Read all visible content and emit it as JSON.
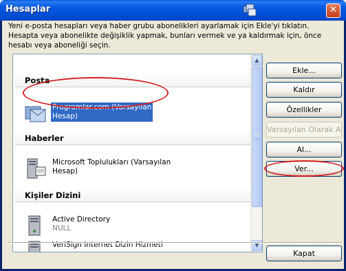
{
  "window": {
    "title": "Hesaplar",
    "close_glyph": "✕",
    "title_icon": "accounts-window-icon"
  },
  "description": "Yeni e-posta hesapları veya haber grubu abonelikleri ayarlamak için Ekle'yi tıklatın. Hesapta veya abonelikte değişiklik yapmak, bunları vermek ve ya kaldırmak için, önce hesabı veya aboneliği seçin.",
  "sections": [
    {
      "header": "Posta",
      "items": [
        {
          "icon": "mail-account-icon",
          "line1": "Programlar.com (Varsayılan",
          "line2": "Hesap)",
          "selected": true
        }
      ]
    },
    {
      "header": "Haberler",
      "items": [
        {
          "icon": "news-server-icon",
          "line1": "Microsoft Toplulukları (Varsayılan",
          "line2": "Hesap)",
          "selected": false
        }
      ]
    },
    {
      "header": "Kişiler Dizini",
      "items": [
        {
          "icon": "directory-server-icon",
          "line1": "Active Directory",
          "line2": "NULL",
          "selected": false
        },
        {
          "icon": "directory-server-icon",
          "line1": "VeriSign Internet Dizin Hizmeti",
          "line2": "",
          "selected": false
        }
      ]
    }
  ],
  "buttons": {
    "add": "Ekle...",
    "remove": "Kaldır",
    "properties": "Özellikler",
    "set_default": "Varsayılan Olarak Ata",
    "import": "Al...",
    "export": "Ver...",
    "close": "Kapat"
  },
  "scrollbar": {
    "up_glyph": "▲",
    "down_glyph": "▼"
  },
  "colors": {
    "title_bar": "#0054e3",
    "selection": "#316ac5",
    "annotation": "#d42020",
    "dialog_bg": "#ece9d8"
  }
}
